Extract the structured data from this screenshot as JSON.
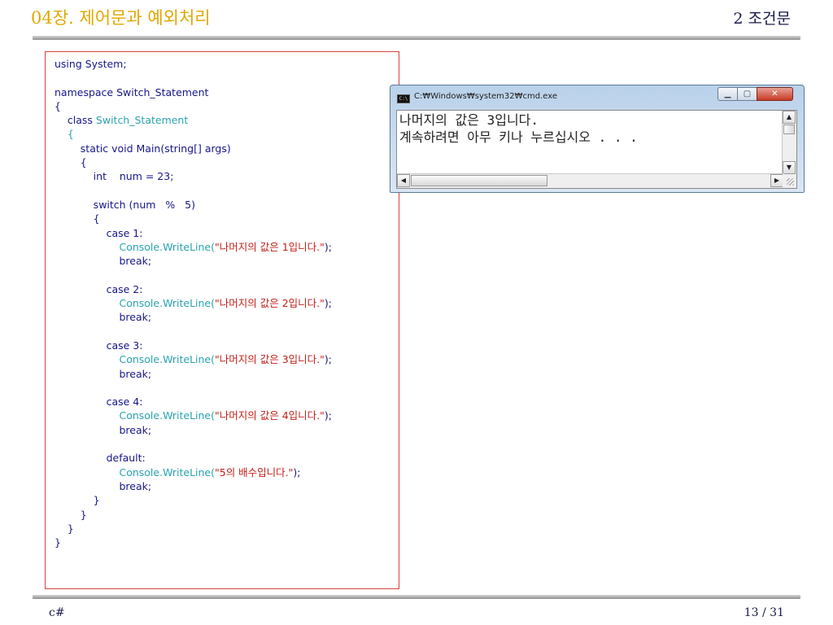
{
  "header": {
    "chapter_title": "04장. 제어문과 예외처리",
    "section_title": "2 조건문"
  },
  "code": {
    "lines": [
      [
        {
          "t": "using System;",
          "c": "kw"
        }
      ],
      [
        {
          "t": "",
          "c": "kw"
        }
      ],
      [
        {
          "t": "namespace Switch_Statement",
          "c": "kw"
        }
      ],
      [
        {
          "t": "{",
          "c": "kw"
        }
      ],
      [
        {
          "t": "    class ",
          "c": "kw"
        },
        {
          "t": "Switch_Statement",
          "c": "type"
        }
      ],
      [
        {
          "t": "    {",
          "c": "type"
        }
      ],
      [
        {
          "t": "        static void Main(string[] args)",
          "c": "kw"
        }
      ],
      [
        {
          "t": "        {",
          "c": "kw"
        }
      ],
      [
        {
          "t": "            int    num = 23;",
          "c": "kw"
        }
      ],
      [
        {
          "t": "",
          "c": "kw"
        }
      ],
      [
        {
          "t": "            switch (num   %   5)",
          "c": "kw"
        }
      ],
      [
        {
          "t": "            {",
          "c": "kw"
        }
      ],
      [
        {
          "t": "                case 1:",
          "c": "kw"
        }
      ],
      [
        {
          "t": "                    Console.WriteLine(",
          "c": "type"
        },
        {
          "t": "\"나머지의 값은 1입니다.\"",
          "c": "str"
        },
        {
          "t": ");",
          "c": "kw"
        }
      ],
      [
        {
          "t": "                    break;",
          "c": "kw"
        }
      ],
      [
        {
          "t": "",
          "c": "kw"
        }
      ],
      [
        {
          "t": "                case 2:",
          "c": "kw"
        }
      ],
      [
        {
          "t": "                    Console.WriteLine(",
          "c": "type"
        },
        {
          "t": "\"나머지의 값은 2입니다.\"",
          "c": "str"
        },
        {
          "t": ");",
          "c": "kw"
        }
      ],
      [
        {
          "t": "                    break;",
          "c": "kw"
        }
      ],
      [
        {
          "t": "",
          "c": "kw"
        }
      ],
      [
        {
          "t": "                case 3:",
          "c": "kw"
        }
      ],
      [
        {
          "t": "                    Console.WriteLine(",
          "c": "type"
        },
        {
          "t": "\"나머지의 값은 3입니다.\"",
          "c": "str"
        },
        {
          "t": ");",
          "c": "kw"
        }
      ],
      [
        {
          "t": "                    break;",
          "c": "kw"
        }
      ],
      [
        {
          "t": "",
          "c": "kw"
        }
      ],
      [
        {
          "t": "                case 4:",
          "c": "kw"
        }
      ],
      [
        {
          "t": "                    Console.WriteLine(",
          "c": "type"
        },
        {
          "t": "\"나머지의 값은 4입니다.\"",
          "c": "str"
        },
        {
          "t": ");",
          "c": "kw"
        }
      ],
      [
        {
          "t": "                    break;",
          "c": "kw"
        }
      ],
      [
        {
          "t": "",
          "c": "kw"
        }
      ],
      [
        {
          "t": "                default:",
          "c": "kw"
        }
      ],
      [
        {
          "t": "                    Console.WriteLine(",
          "c": "type"
        },
        {
          "t": "\"5의 배수입니다.\"",
          "c": "str"
        },
        {
          "t": ");",
          "c": "kw"
        }
      ],
      [
        {
          "t": "                    break;",
          "c": "kw"
        }
      ],
      [
        {
          "t": "            }",
          "c": "kw"
        }
      ],
      [
        {
          "t": "        }",
          "c": "kw"
        }
      ],
      [
        {
          "t": "    }",
          "c": "kw"
        }
      ],
      [
        {
          "t": "}",
          "c": "kw"
        }
      ]
    ]
  },
  "console_window": {
    "title": "C:₩Windows₩system32₩cmd.exe",
    "icon": "cmd-icon",
    "output_line1": "나머지의 값은 3입니다.",
    "output_line2": "계속하려면 아무 키나 누르십시오 . . ."
  },
  "footer": {
    "left": "c#",
    "right": "13 / 31"
  },
  "colors": {
    "chapter": "#e0a800",
    "code_keyword": "#16168a",
    "code_type": "#2aa3b0",
    "code_string": "#c0201a",
    "code_border": "#d84040"
  }
}
